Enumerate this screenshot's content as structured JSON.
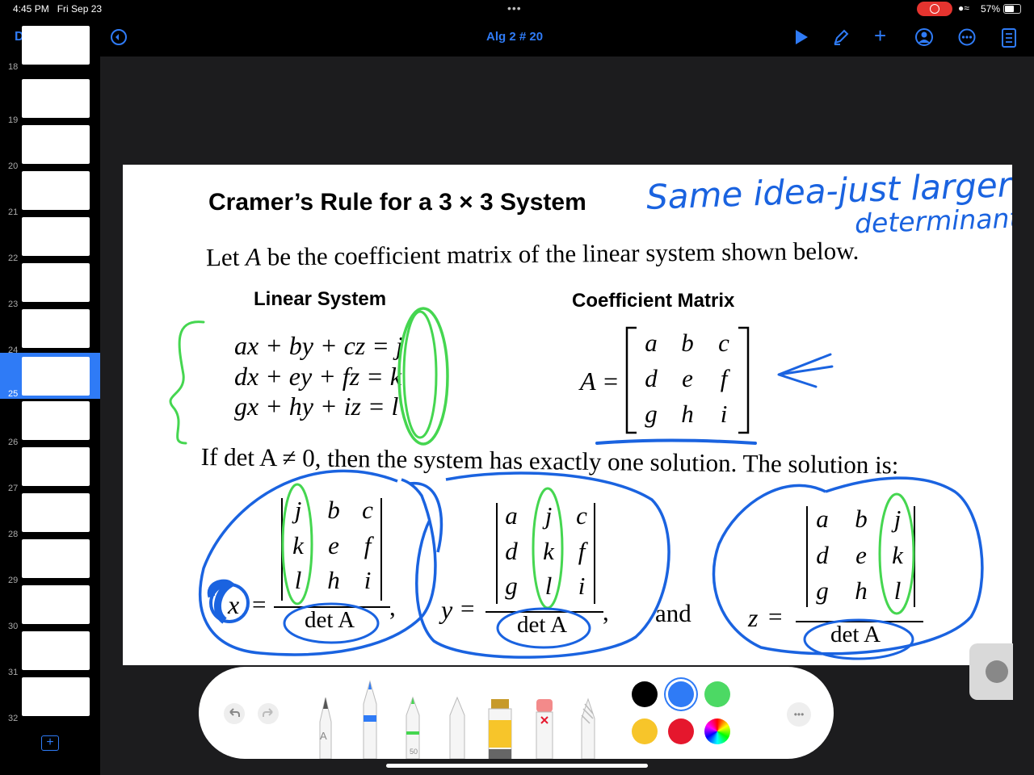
{
  "status_bar": {
    "time": "4:45 PM",
    "date": "Fri Sep 23",
    "battery": "57%"
  },
  "toolbar": {
    "done_label": "Done",
    "document_title": "Alg 2 # 20",
    "icons": [
      "sidebar-icon",
      "undo-icon",
      "play-icon",
      "markup-icon",
      "add-icon",
      "collaborate-icon",
      "more-icon",
      "format-icon"
    ]
  },
  "sidebar": {
    "slides": [
      {
        "number": "18"
      },
      {
        "number": "19"
      },
      {
        "number": "20"
      },
      {
        "number": "21"
      },
      {
        "number": "22"
      },
      {
        "number": "23"
      },
      {
        "number": "24"
      },
      {
        "number": "25",
        "selected": true
      },
      {
        "number": "26"
      },
      {
        "number": "27"
      },
      {
        "number": "28"
      },
      {
        "number": "29"
      },
      {
        "number": "30"
      },
      {
        "number": "31"
      },
      {
        "number": "32"
      }
    ],
    "add_label": "+"
  },
  "slide": {
    "title_a": "Cramer’s Rule for a 3",
    "title_times": "×",
    "title_b": "3 System",
    "intro_a": "Let",
    "intro_var": "A",
    "intro_b": "be the coefficient matrix of the linear system shown below.",
    "linear_header": "Linear System",
    "matrix_header": "Coefficient Matrix",
    "equations": [
      "ax + by + cz = j",
      "dx + ey + fz = k",
      "gx + hy + iz = l"
    ],
    "matrix_label": "A =",
    "matrix": [
      [
        "a",
        "b",
        "c"
      ],
      [
        "d",
        "e",
        "f"
      ],
      [
        "g",
        "h",
        "i"
      ]
    ],
    "condition": "If det A ≠ 0, then the system has exactly one solution. The solution is:",
    "sol_x": {
      "var": "x",
      "eq": "=",
      "matrix": [
        [
          "j",
          "b",
          "c"
        ],
        [
          "k",
          "e",
          "f"
        ],
        [
          "l",
          "h",
          "i"
        ]
      ],
      "den": "det A",
      "sep": ","
    },
    "sol_y": {
      "var": "y",
      "eq": "=",
      "matrix": [
        [
          "a",
          "j",
          "c"
        ],
        [
          "d",
          "k",
          "f"
        ],
        [
          "g",
          "l",
          "i"
        ]
      ],
      "den": "det A",
      "sep": ","
    },
    "and_label": "and",
    "sol_z": {
      "var": "z",
      "eq": "=",
      "matrix": [
        [
          "a",
          "b",
          "j"
        ],
        [
          "d",
          "e",
          "k"
        ],
        [
          "g",
          "h",
          "l"
        ]
      ],
      "den": "det A"
    },
    "handwriting_line1": "Same idea-just larger",
    "handwriting_line2": "determinant"
  },
  "pen_toolbar": {
    "tools": [
      "pencil",
      "pen",
      "marker",
      "eraser-pen",
      "highlighter",
      "eraser",
      "crayon"
    ],
    "size_label": "50",
    "pencil_label": "A",
    "colors": [
      "#000000",
      "#2f7bf6",
      "#4cd964",
      "#f7c52a",
      "#e5172d",
      "spectrum"
    ],
    "more_label": "•••"
  }
}
